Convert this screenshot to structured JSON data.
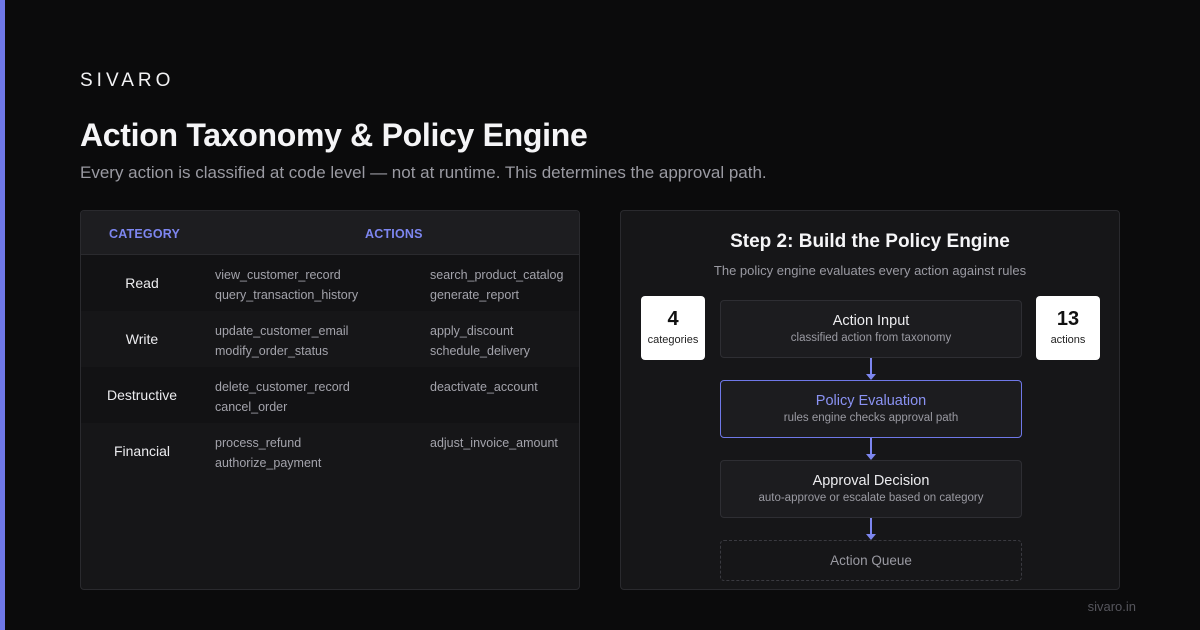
{
  "brand": "SIVARO",
  "title": "Action Taxonomy & Policy Engine",
  "subtitle": "Every action is classified at code level — not at runtime. This determines the approval path.",
  "table": {
    "headers": {
      "category": "CATEGORY",
      "actions": "ACTIONS"
    },
    "rows": [
      {
        "category": "Read",
        "col1": "view_customer_record\nquery_transaction_history",
        "col2": "search_product_catalog\ngenerate_report"
      },
      {
        "category": "Write",
        "col1": "update_customer_email\nmodify_order_status",
        "col2": "apply_discount\nschedule_delivery"
      },
      {
        "category": "Destructive",
        "col1": "delete_customer_record\ncancel_order",
        "col2": "deactivate_account"
      },
      {
        "category": "Financial",
        "col1": "process_refund\nauthorize_payment",
        "col2": "adjust_invoice_amount"
      }
    ]
  },
  "engine": {
    "title": "Step 2: Build the Policy Engine",
    "subtitle": "The policy engine evaluates every action against rules",
    "stats": [
      {
        "value": "4",
        "label": "categories"
      },
      {
        "value": "13",
        "label": "actions"
      }
    ],
    "nodes": [
      {
        "title": "Action Input",
        "sub": "classified action from taxonomy"
      },
      {
        "title": "Policy Evaluation",
        "sub": "rules engine checks approval path"
      },
      {
        "title": "Approval Decision",
        "sub": "auto-approve or escalate based on category"
      },
      {
        "title": "Action Queue"
      }
    ]
  },
  "footer": "sivaro.in",
  "colors": {
    "accent": "#6f78e8",
    "background": "#0b0b0c",
    "panel": "#161618"
  }
}
